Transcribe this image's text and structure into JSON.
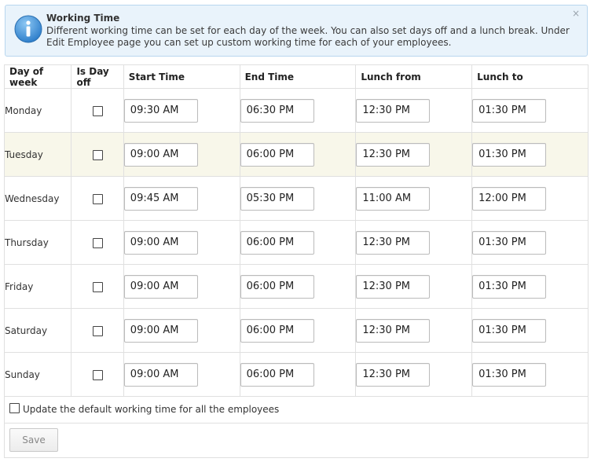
{
  "notice": {
    "title": "Working Time",
    "body": "Different working time can be set for each day of the week. You can also set days off and a lunch break. Under Edit Employee page you can set up custom working time for each of your employees.",
    "close": "×",
    "icon": "info-icon",
    "accent": "#2f8ad8"
  },
  "table": {
    "headers": {
      "day": "Day of week",
      "off": "Is Day off",
      "start": "Start Time",
      "end": "End Time",
      "lunch_from": "Lunch from",
      "lunch_to": "Lunch to"
    },
    "rows": [
      {
        "day": "Monday",
        "off": false,
        "start": "09:30 AM",
        "end": "06:30 PM",
        "lunch_from": "12:30 PM",
        "lunch_to": "01:30 PM"
      },
      {
        "day": "Tuesday",
        "off": false,
        "start": "09:00 AM",
        "end": "06:00 PM",
        "lunch_from": "12:30 PM",
        "lunch_to": "01:30 PM"
      },
      {
        "day": "Wednesday",
        "off": false,
        "start": "09:45 AM",
        "end": "05:30 PM",
        "lunch_from": "11:00 AM",
        "lunch_to": "12:00 PM"
      },
      {
        "day": "Thursday",
        "off": false,
        "start": "09:00 AM",
        "end": "06:00 PM",
        "lunch_from": "12:30 PM",
        "lunch_to": "01:30 PM"
      },
      {
        "day": "Friday",
        "off": false,
        "start": "09:00 AM",
        "end": "06:00 PM",
        "lunch_from": "12:30 PM",
        "lunch_to": "01:30 PM"
      },
      {
        "day": "Saturday",
        "off": false,
        "start": "09:00 AM",
        "end": "06:00 PM",
        "lunch_from": "12:30 PM",
        "lunch_to": "01:30 PM"
      },
      {
        "day": "Sunday",
        "off": false,
        "start": "09:00 AM",
        "end": "06:00 PM",
        "lunch_from": "12:30 PM",
        "lunch_to": "01:30 PM"
      }
    ],
    "highlight_color": "#f8f7ea"
  },
  "footer": {
    "update_default_label": "Update the default working time for all the employees",
    "update_default_checked": false,
    "save_label": "Save"
  }
}
